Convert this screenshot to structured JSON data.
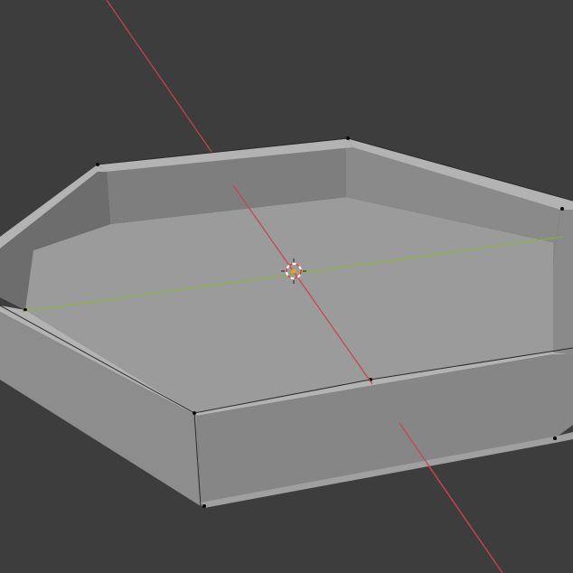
{
  "viewport": {
    "background": "#3d3d3d",
    "mode": "3d-viewport"
  },
  "axes": {
    "x_axis_color": "#c8434e",
    "y_axis_color": "#8ab534"
  },
  "object": {
    "name": "",
    "shape": "hexagonal-tray",
    "face_colors": {
      "floor": "#9b9b9b",
      "inner_wall_back": "#7e7e7e",
      "inner_wall_left": "#6d6d6d",
      "inner_wall_right": "#8a8a8a",
      "rim_top": "#b3b3b3",
      "outer_wall_front": "#868686",
      "outer_wall_left": "#8d8d8d",
      "outer_wall_right": "#8a8a8a",
      "outer_bottom_edge": "#a0a0a0"
    }
  },
  "cursor_3d": {
    "icon": "3d-cursor-icon",
    "ring_color_a": "#d24a4a",
    "ring_color_b": "#ffffff",
    "origin_color": "#f0a020"
  }
}
